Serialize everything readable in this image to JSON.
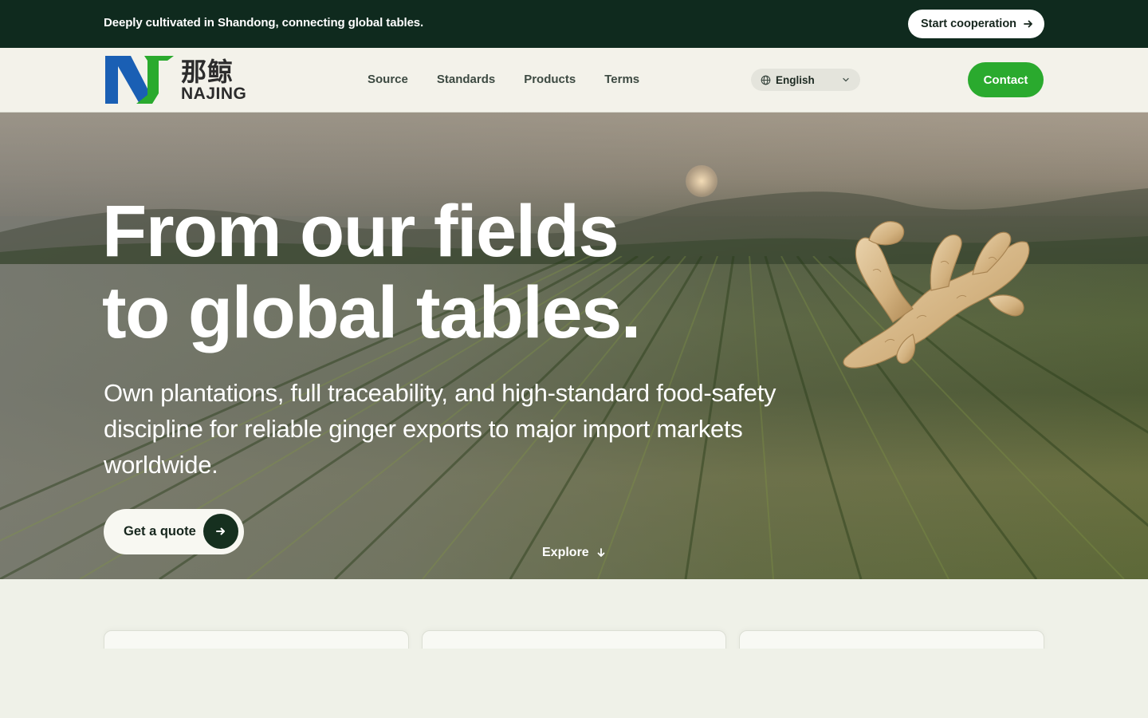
{
  "topbar": {
    "tagline": "Deeply cultivated in Shandong, connecting global tables.",
    "cooperation_label": "Start cooperation"
  },
  "header": {
    "logo": {
      "cn": "那鲸",
      "en": "NAJING"
    },
    "nav": [
      "Source",
      "Standards",
      "Products",
      "Terms"
    ],
    "language": "English",
    "contact_label": "Contact"
  },
  "hero": {
    "title_line1": "From our fields",
    "title_line2": "to global tables.",
    "subtitle": "Own plantations, full traceability, and high-standard food-safety discipline for reliable ginger exports to major import markets worldwide.",
    "quote_label": "Get a quote",
    "explore_label": "Explore"
  },
  "colors": {
    "topbar_bg": "#0f2a1e",
    "accent_green": "#2aaa2e",
    "logo_blue": "#1a5fb4",
    "logo_green": "#2aaa2e",
    "page_bg": "#eff1e8"
  },
  "icons": {
    "cooperation": "arrow-right-icon",
    "language": "globe-icon",
    "language_toggle": "chevron-down-icon",
    "quote": "arrow-right-icon",
    "explore": "arrow-down-icon"
  }
}
